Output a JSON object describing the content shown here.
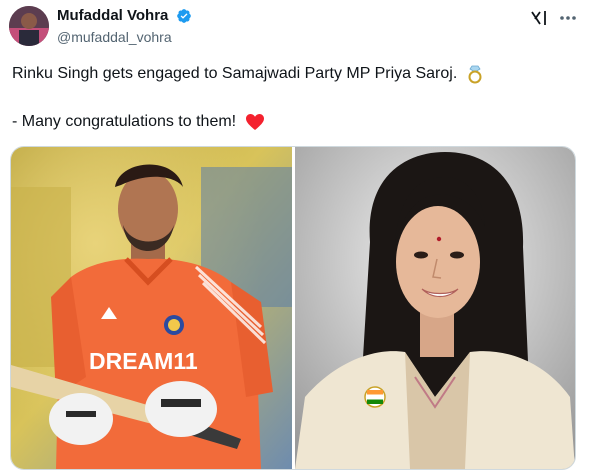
{
  "author": {
    "display_name": "Mufaddal Vohra",
    "handle": "@mufaddal_vohra",
    "verified": true,
    "verified_color": "#1d9bf0"
  },
  "tweet": {
    "line1": "Rinku Singh gets engaged to Samajwadi Party MP Priya Saroj.",
    "line1_emoji": "ring-emoji",
    "line2": "",
    "line3": "- Many congratulations to them!",
    "line3_emoji": "red-heart-emoji"
  },
  "media": {
    "photo_left": "cricketer-photo",
    "photo_left_jersey_text": "DREAM11",
    "photo_right": "woman-portrait-photo"
  },
  "icons": {
    "grok": "grok-icon",
    "more": "more-icon"
  },
  "colors": {
    "text": "#0f1419",
    "secondary": "#536471",
    "heart": "#f4212e",
    "jersey": "#f26b3a"
  }
}
